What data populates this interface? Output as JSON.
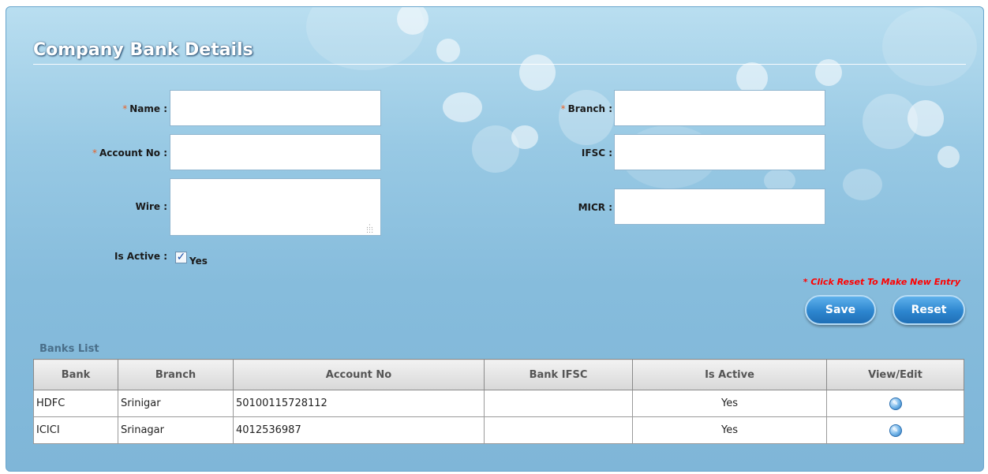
{
  "page": {
    "title": "Company Bank Details"
  },
  "form": {
    "name_label": "Name :",
    "account_no_label": "Account No :",
    "wire_label": "Wire :",
    "branch_label": "Branch :",
    "ifsc_label": "IFSC :",
    "micr_label": "MICR :",
    "is_active_label": "Is Active :",
    "is_active_value_label": "Yes",
    "required_marker": "*",
    "name_value": "",
    "account_no_value": "",
    "wire_value": "",
    "branch_value": "",
    "ifsc_value": "",
    "micr_value": "",
    "is_active_checked": true,
    "reset_note": "* Click Reset To Make New Entry",
    "save_label": "Save",
    "reset_label": "Reset"
  },
  "banks_list": {
    "title": "Banks List",
    "columns": [
      "Bank",
      "Branch",
      "Account No",
      "Bank IFSC",
      "Is Active",
      "View/Edit"
    ],
    "rows": [
      {
        "bank": "HDFC",
        "branch": "Srinigar",
        "account_no": "50100115728112",
        "ifsc": "",
        "is_active": "Yes",
        "action_icon": "edit-icon"
      },
      {
        "bank": "ICICI",
        "branch": "Srinagar",
        "account_no": "4012536987",
        "ifsc": "",
        "is_active": "Yes",
        "action_icon": "edit-icon"
      }
    ]
  },
  "colors": {
    "required": "#e8632a",
    "note": "#ff0000",
    "button": "#2d86cf",
    "section_title": "#4a6f8a"
  }
}
